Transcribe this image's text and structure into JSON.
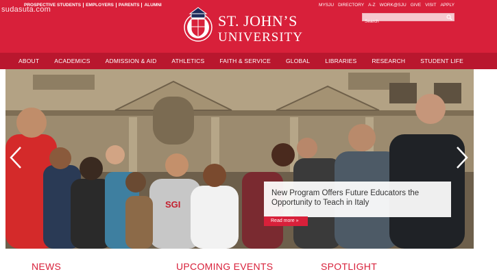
{
  "watermark": "sudasuta.com",
  "audience_links": [
    "PROSPECTIVE STUDENTS",
    "EMPLOYERS",
    "PARENTS",
    "ALUMNI"
  ],
  "utility_links": [
    "MYSJU",
    "DIRECTORY",
    "A-Z",
    "WORK@SJU",
    "GIVE",
    "VISIT",
    "APPLY"
  ],
  "search": {
    "placeholder": "Search"
  },
  "logo": {
    "line1": "ST. JOHN’S",
    "line2": "UNIVERSITY"
  },
  "nav": [
    "ABOUT",
    "ACADEMICS",
    "ADMISSION & AID",
    "ATHLETICS",
    "FAITH & SERVICE",
    "GLOBAL",
    "LIBRARIES",
    "RESEARCH",
    "STUDENT LIFE"
  ],
  "hero": {
    "shirt_text": "SGI",
    "caption_title": "New Program Offers Future Educators the Opportunity to Teach in Italy",
    "read_more": "Read more »"
  },
  "sections": {
    "news": "NEWS",
    "events": "UPCOMING EVENTS",
    "spotlight": "SPOTLIGHT"
  },
  "colors": {
    "brand_red": "#d8203a",
    "nav_red": "#b9172e"
  }
}
